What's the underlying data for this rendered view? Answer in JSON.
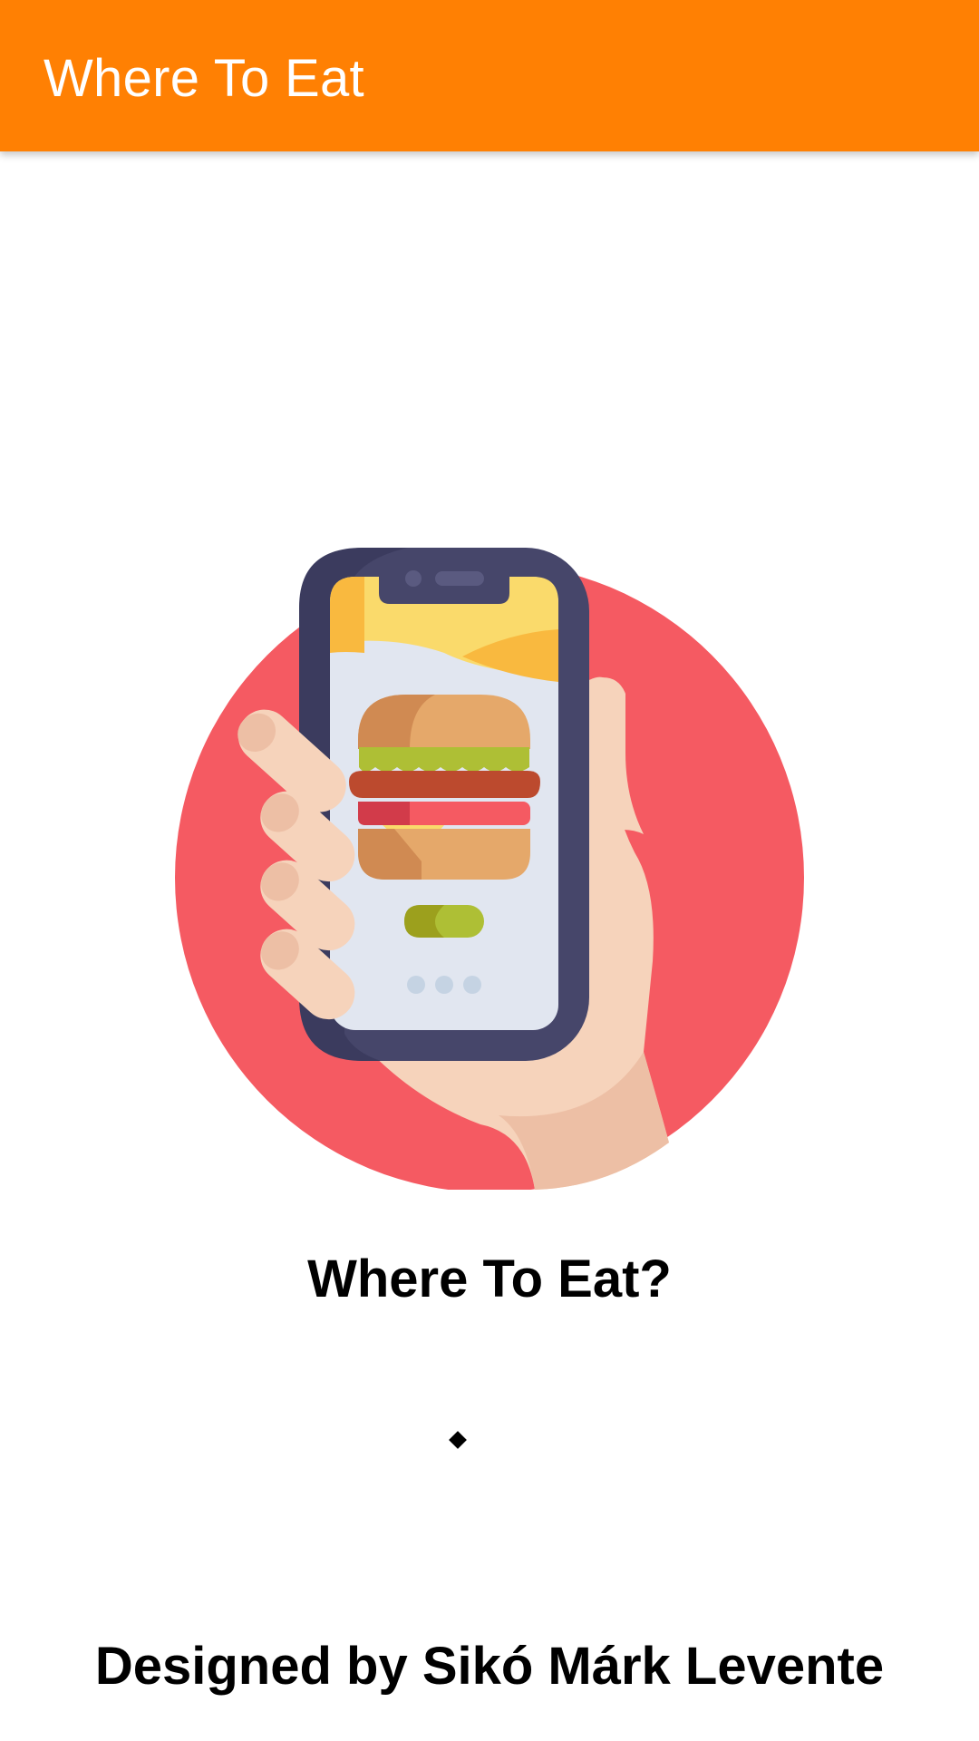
{
  "app_bar": {
    "title": "Where To Eat"
  },
  "hero": {
    "icon": "hand-holding-phone-burger-illustration"
  },
  "headline": "Where To Eat?",
  "loader": {
    "icon": "loading-indicator-icon"
  },
  "footer": {
    "credit": "Designed by Sikó Márk Levente"
  },
  "colors": {
    "app_bar": "#FF8003",
    "circle": "#F55A62",
    "phone_frame": "#46466A",
    "skin": "#F6D3BB"
  }
}
